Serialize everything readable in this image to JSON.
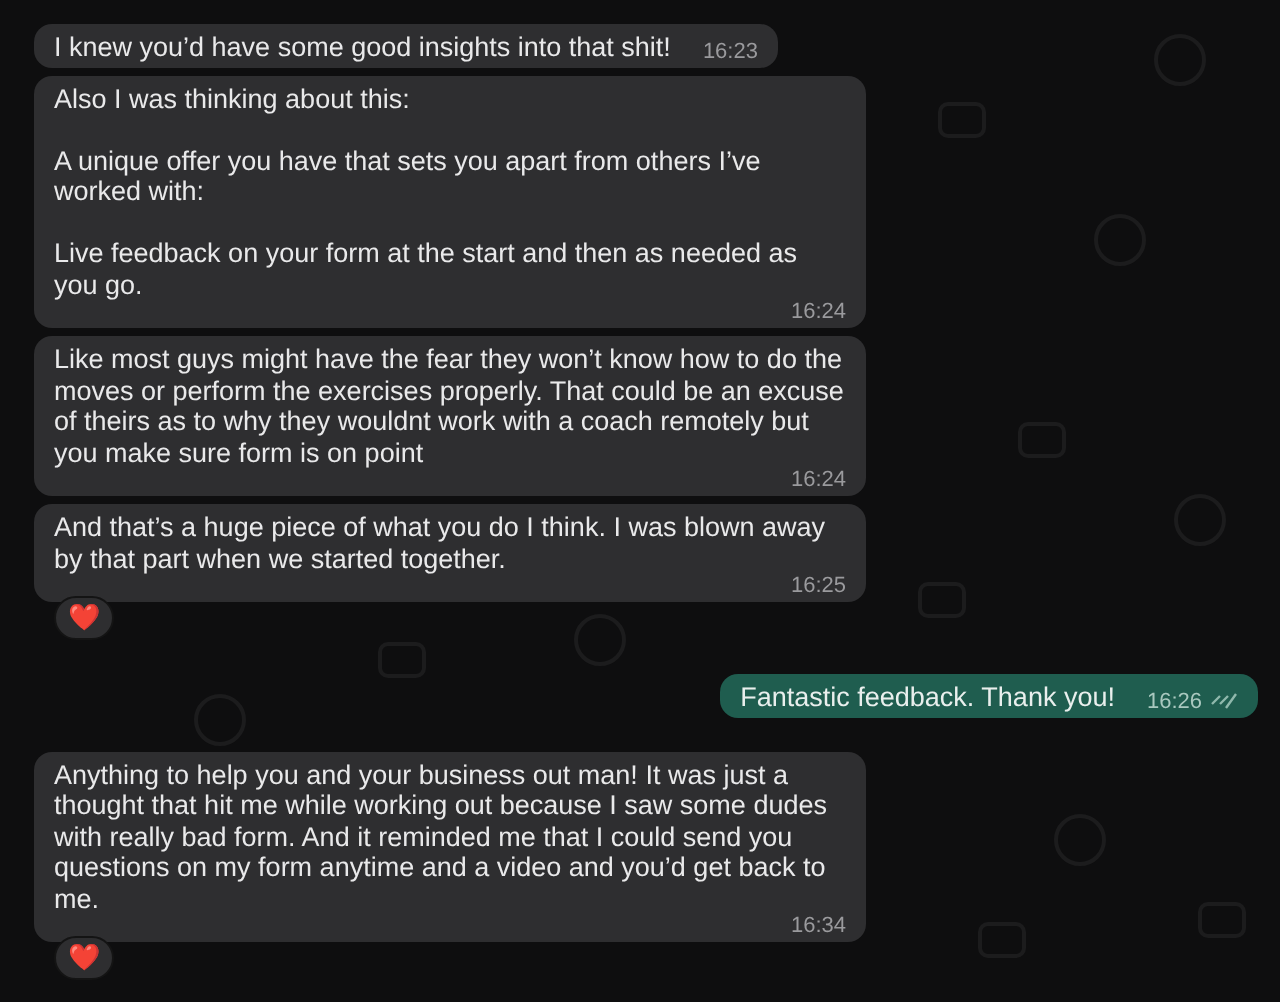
{
  "messages": [
    {
      "kind": "incoming",
      "paragraphs": [
        "I knew you’d have some good insights into that shit!"
      ],
      "time": "16:23"
    },
    {
      "kind": "incoming",
      "paragraphs": [
        "Also I was thinking about this:",
        "A unique offer you have that sets you apart from others I’ve worked with:",
        "Live feedback on your form at the start and then as needed as you go."
      ],
      "time": "16:24"
    },
    {
      "kind": "incoming",
      "paragraphs": [
        "Like most guys might have the fear they won’t know how to do the moves or perform the exercises properly. That could be an excuse of theirs as to why they wouldnt work with a coach remotely but you make sure form is on point"
      ],
      "time": "16:24"
    },
    {
      "kind": "incoming",
      "paragraphs": [
        "And that’s a huge piece of what you do I think. I was blown away by that part when we started together."
      ],
      "time": "16:25",
      "reaction": "❤️"
    },
    {
      "kind": "outgoing",
      "paragraphs": [
        "Fantastic feedback. Thank you!"
      ],
      "time": "16:26",
      "read": false
    },
    {
      "kind": "incoming",
      "paragraphs": [
        "Anything to help you and your business out man! It was just a thought that hit me while working out because I saw some dudes with really bad form. And it reminded me that I could send you questions on my form anytime and a video and you’d get back to me."
      ],
      "time": "16:34",
      "reaction": "❤️"
    }
  ]
}
